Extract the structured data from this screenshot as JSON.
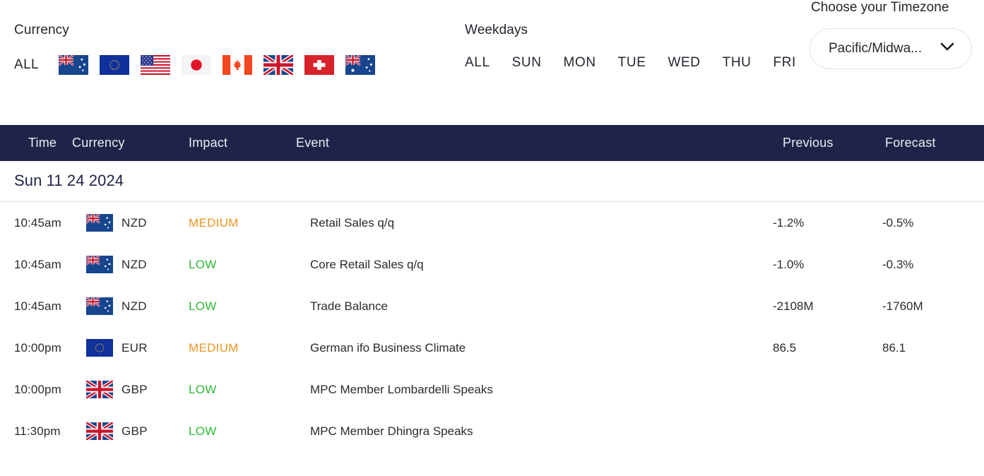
{
  "filters": {
    "currency": {
      "label": "Currency",
      "all_label": "ALL",
      "flags": [
        {
          "name": "nzd-flag",
          "code": "NZD"
        },
        {
          "name": "eur-flag",
          "code": "EUR"
        },
        {
          "name": "usd-flag",
          "code": "USD"
        },
        {
          "name": "jpy-flag",
          "code": "JPY"
        },
        {
          "name": "cad-flag",
          "code": "CAD"
        },
        {
          "name": "gbp-flag",
          "code": "GBP"
        },
        {
          "name": "chf-flag",
          "code": "CHF"
        },
        {
          "name": "aud-flag",
          "code": "AUD"
        }
      ]
    },
    "weekdays": {
      "label": "Weekdays",
      "items": [
        "ALL",
        "SUN",
        "MON",
        "TUE",
        "WED",
        "THU",
        "FRI"
      ]
    },
    "timezone": {
      "label": "Choose your Timezone",
      "selected": "Pacific/Midwa...",
      "chevron_icon": "chevron-down-icon"
    }
  },
  "table": {
    "headers": {
      "time": "Time",
      "currency": "Currency",
      "impact": "Impact",
      "event": "Event",
      "previous": "Previous",
      "forecast": "Forecast"
    },
    "date_group": "Sun 11 24 2024",
    "rows": [
      {
        "time": "10:45am",
        "flag": "nzd-flag",
        "currency": "NZD",
        "impact": "MEDIUM",
        "event": "Retail Sales q/q",
        "previous": "-1.2%",
        "forecast": "-0.5%"
      },
      {
        "time": "10:45am",
        "flag": "nzd-flag",
        "currency": "NZD",
        "impact": "LOW",
        "event": "Core Retail Sales q/q",
        "previous": "-1.0%",
        "forecast": "-0.3%"
      },
      {
        "time": "10:45am",
        "flag": "nzd-flag",
        "currency": "NZD",
        "impact": "LOW",
        "event": "Trade Balance",
        "previous": "-2108M",
        "forecast": "-1760M"
      },
      {
        "time": "10:00pm",
        "flag": "eur-flag",
        "currency": "EUR",
        "impact": "MEDIUM",
        "event": "German ifo Business Climate",
        "previous": "86.5",
        "forecast": "86.1"
      },
      {
        "time": "10:00pm",
        "flag": "gbp-flag",
        "currency": "GBP",
        "impact": "LOW",
        "event": "MPC Member Lombardelli Speaks",
        "previous": "",
        "forecast": ""
      },
      {
        "time": "11:30pm",
        "flag": "gbp-flag",
        "currency": "GBP",
        "impact": "LOW",
        "event": "MPC Member Dhingra Speaks",
        "previous": "",
        "forecast": ""
      }
    ]
  },
  "colors": {
    "header_bar": "#1f2347",
    "impact_high": "#e53935",
    "impact_medium": "#ec9722",
    "impact_low": "#2fb937"
  }
}
